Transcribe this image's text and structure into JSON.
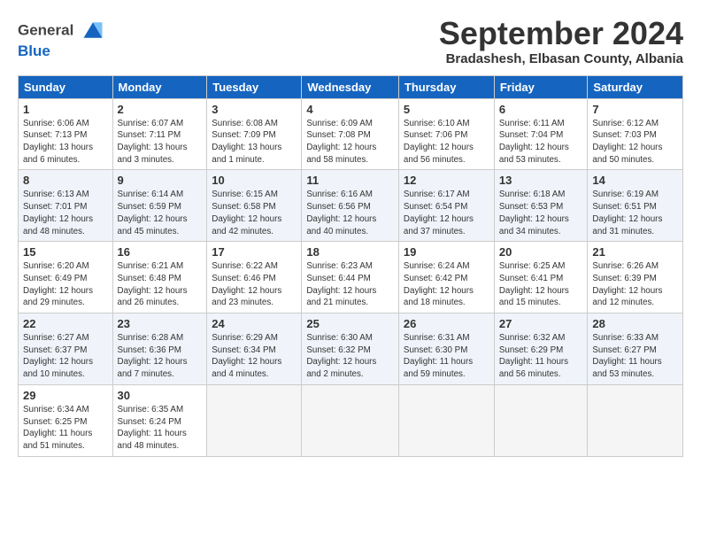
{
  "header": {
    "logo_line1": "General",
    "logo_line2": "Blue",
    "month": "September 2024",
    "location": "Bradashesh, Elbasan County, Albania"
  },
  "columns": [
    "Sunday",
    "Monday",
    "Tuesday",
    "Wednesday",
    "Thursday",
    "Friday",
    "Saturday"
  ],
  "weeks": [
    [
      {
        "day": "1",
        "info": "Sunrise: 6:06 AM\nSunset: 7:13 PM\nDaylight: 13 hours\nand 6 minutes."
      },
      {
        "day": "2",
        "info": "Sunrise: 6:07 AM\nSunset: 7:11 PM\nDaylight: 13 hours\nand 3 minutes."
      },
      {
        "day": "3",
        "info": "Sunrise: 6:08 AM\nSunset: 7:09 PM\nDaylight: 13 hours\nand 1 minute."
      },
      {
        "day": "4",
        "info": "Sunrise: 6:09 AM\nSunset: 7:08 PM\nDaylight: 12 hours\nand 58 minutes."
      },
      {
        "day": "5",
        "info": "Sunrise: 6:10 AM\nSunset: 7:06 PM\nDaylight: 12 hours\nand 56 minutes."
      },
      {
        "day": "6",
        "info": "Sunrise: 6:11 AM\nSunset: 7:04 PM\nDaylight: 12 hours\nand 53 minutes."
      },
      {
        "day": "7",
        "info": "Sunrise: 6:12 AM\nSunset: 7:03 PM\nDaylight: 12 hours\nand 50 minutes."
      }
    ],
    [
      {
        "day": "8",
        "info": "Sunrise: 6:13 AM\nSunset: 7:01 PM\nDaylight: 12 hours\nand 48 minutes."
      },
      {
        "day": "9",
        "info": "Sunrise: 6:14 AM\nSunset: 6:59 PM\nDaylight: 12 hours\nand 45 minutes."
      },
      {
        "day": "10",
        "info": "Sunrise: 6:15 AM\nSunset: 6:58 PM\nDaylight: 12 hours\nand 42 minutes."
      },
      {
        "day": "11",
        "info": "Sunrise: 6:16 AM\nSunset: 6:56 PM\nDaylight: 12 hours\nand 40 minutes."
      },
      {
        "day": "12",
        "info": "Sunrise: 6:17 AM\nSunset: 6:54 PM\nDaylight: 12 hours\nand 37 minutes."
      },
      {
        "day": "13",
        "info": "Sunrise: 6:18 AM\nSunset: 6:53 PM\nDaylight: 12 hours\nand 34 minutes."
      },
      {
        "day": "14",
        "info": "Sunrise: 6:19 AM\nSunset: 6:51 PM\nDaylight: 12 hours\nand 31 minutes."
      }
    ],
    [
      {
        "day": "15",
        "info": "Sunrise: 6:20 AM\nSunset: 6:49 PM\nDaylight: 12 hours\nand 29 minutes."
      },
      {
        "day": "16",
        "info": "Sunrise: 6:21 AM\nSunset: 6:48 PM\nDaylight: 12 hours\nand 26 minutes."
      },
      {
        "day": "17",
        "info": "Sunrise: 6:22 AM\nSunset: 6:46 PM\nDaylight: 12 hours\nand 23 minutes."
      },
      {
        "day": "18",
        "info": "Sunrise: 6:23 AM\nSunset: 6:44 PM\nDaylight: 12 hours\nand 21 minutes."
      },
      {
        "day": "19",
        "info": "Sunrise: 6:24 AM\nSunset: 6:42 PM\nDaylight: 12 hours\nand 18 minutes."
      },
      {
        "day": "20",
        "info": "Sunrise: 6:25 AM\nSunset: 6:41 PM\nDaylight: 12 hours\nand 15 minutes."
      },
      {
        "day": "21",
        "info": "Sunrise: 6:26 AM\nSunset: 6:39 PM\nDaylight: 12 hours\nand 12 minutes."
      }
    ],
    [
      {
        "day": "22",
        "info": "Sunrise: 6:27 AM\nSunset: 6:37 PM\nDaylight: 12 hours\nand 10 minutes."
      },
      {
        "day": "23",
        "info": "Sunrise: 6:28 AM\nSunset: 6:36 PM\nDaylight: 12 hours\nand 7 minutes."
      },
      {
        "day": "24",
        "info": "Sunrise: 6:29 AM\nSunset: 6:34 PM\nDaylight: 12 hours\nand 4 minutes."
      },
      {
        "day": "25",
        "info": "Sunrise: 6:30 AM\nSunset: 6:32 PM\nDaylight: 12 hours\nand 2 minutes."
      },
      {
        "day": "26",
        "info": "Sunrise: 6:31 AM\nSunset: 6:30 PM\nDaylight: 11 hours\nand 59 minutes."
      },
      {
        "day": "27",
        "info": "Sunrise: 6:32 AM\nSunset: 6:29 PM\nDaylight: 11 hours\nand 56 minutes."
      },
      {
        "day": "28",
        "info": "Sunrise: 6:33 AM\nSunset: 6:27 PM\nDaylight: 11 hours\nand 53 minutes."
      }
    ],
    [
      {
        "day": "29",
        "info": "Sunrise: 6:34 AM\nSunset: 6:25 PM\nDaylight: 11 hours\nand 51 minutes."
      },
      {
        "day": "30",
        "info": "Sunrise: 6:35 AM\nSunset: 6:24 PM\nDaylight: 11 hours\nand 48 minutes."
      },
      {
        "day": "",
        "info": ""
      },
      {
        "day": "",
        "info": ""
      },
      {
        "day": "",
        "info": ""
      },
      {
        "day": "",
        "info": ""
      },
      {
        "day": "",
        "info": ""
      }
    ]
  ]
}
